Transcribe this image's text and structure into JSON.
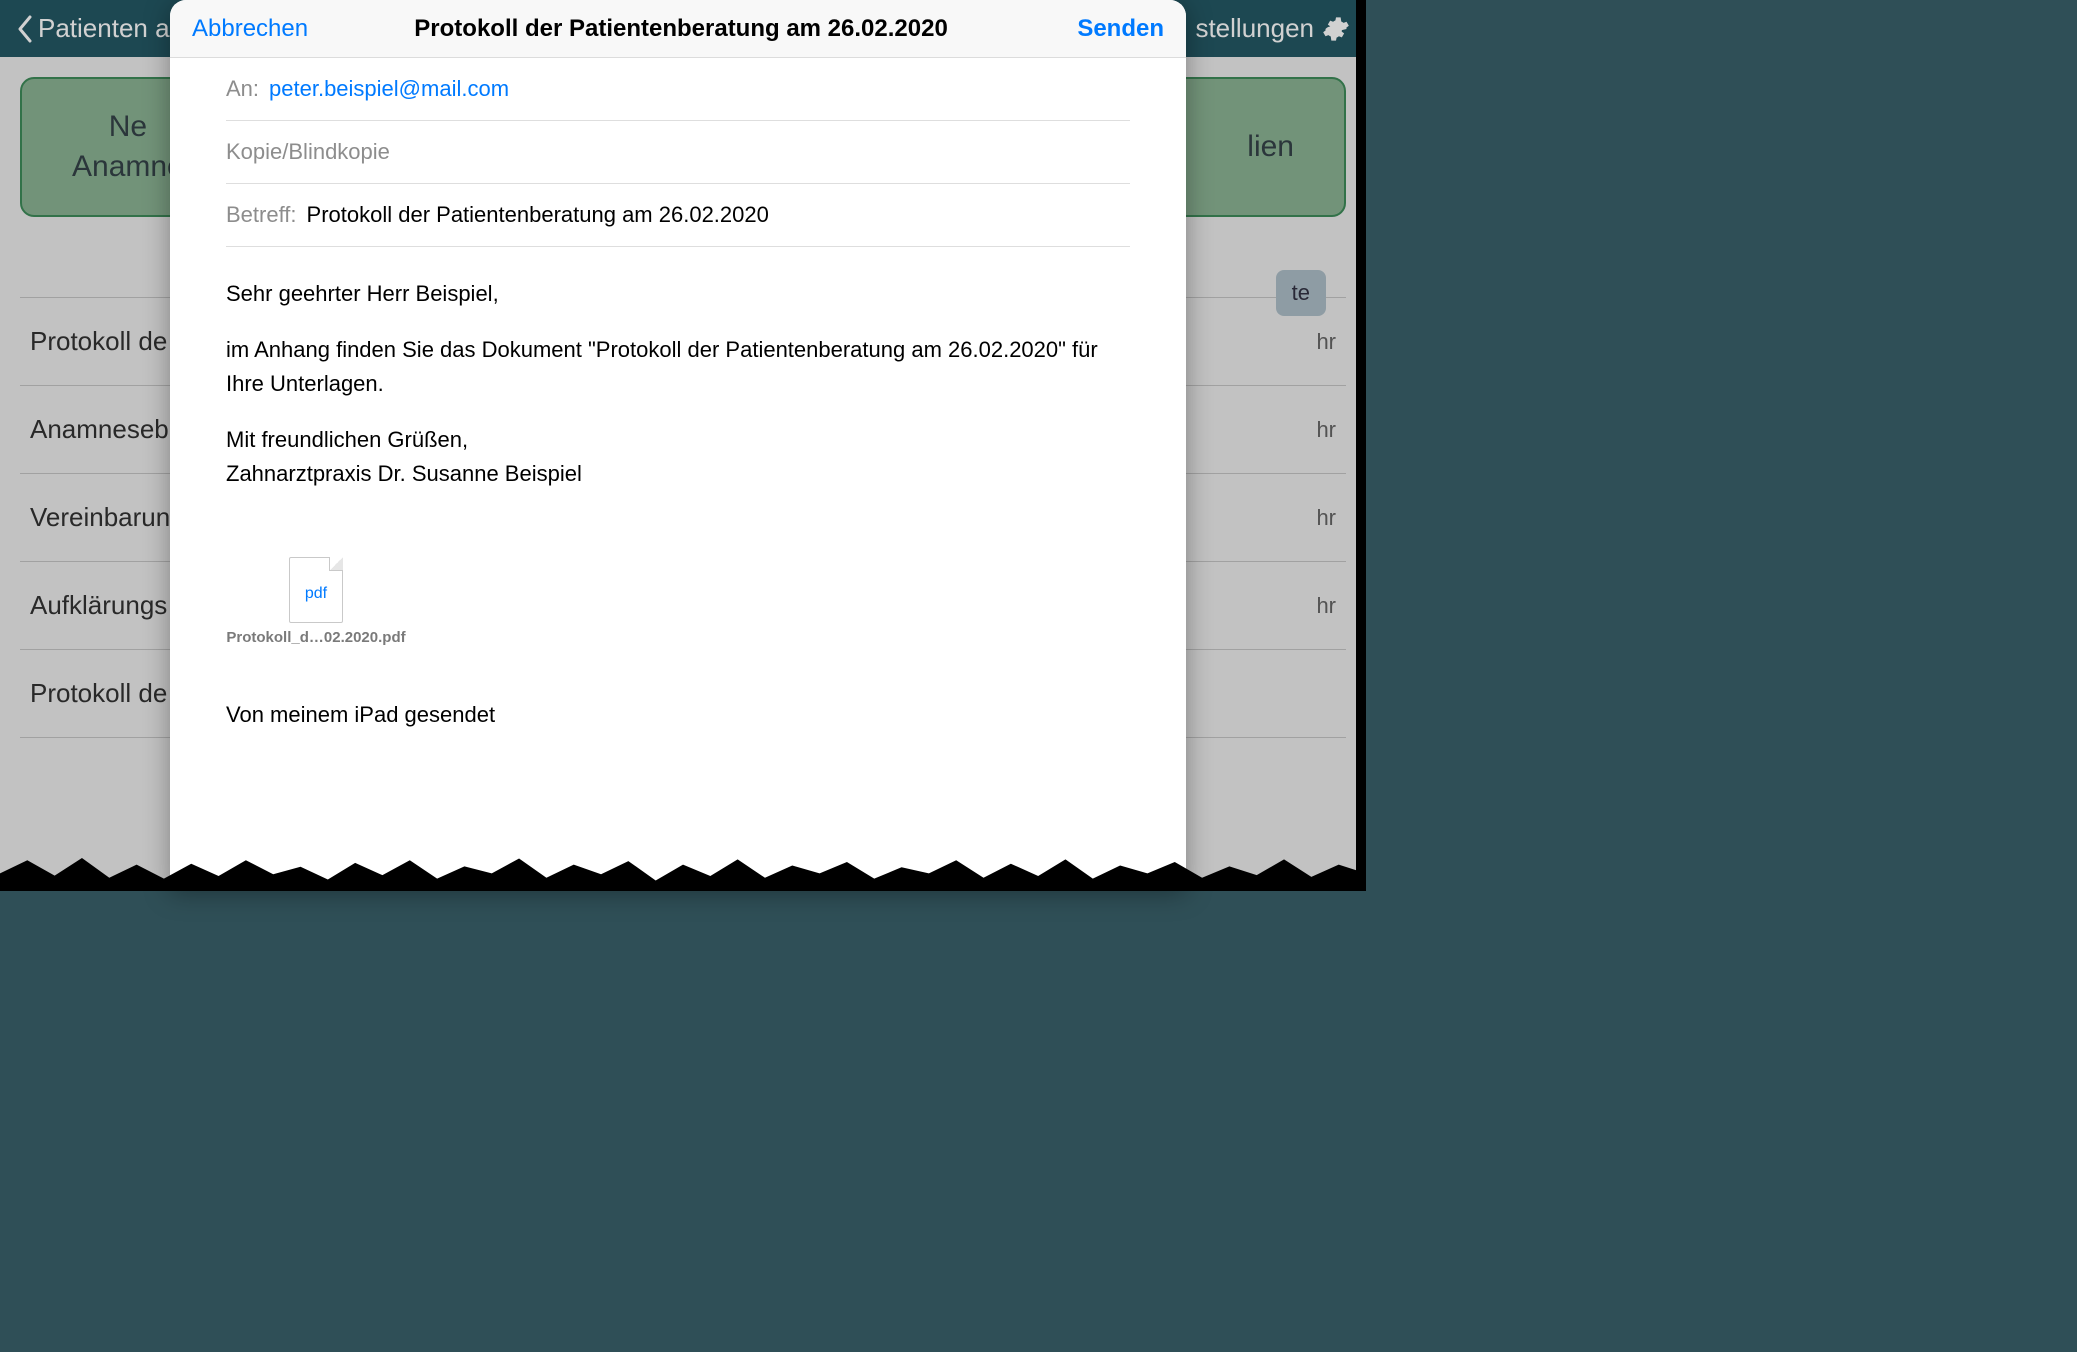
{
  "bg": {
    "back_label": "Patienten aus",
    "settings_label": "stellungen",
    "green_left_l1": "Ne",
    "green_left_l2": "Anamne",
    "green_right": "lien",
    "badge": "te",
    "list": [
      {
        "title": "Protokoll de",
        "time": "hr"
      },
      {
        "title": "Anamneseb",
        "time": "hr"
      },
      {
        "title": "Vereinbarun",
        "time": "hr"
      },
      {
        "title": "Aufklärungs",
        "time": "hr"
      },
      {
        "title": "Protokoll de",
        "time": ""
      }
    ]
  },
  "modal": {
    "cancel": "Abbrechen",
    "title": "Protokoll der Patientenberatung am 26.02.2020",
    "send": "Senden",
    "to_label": "An:",
    "to_value": "peter.beispiel@mail.com",
    "cc_label": "Kopie/Blindkopie",
    "subject_label": "Betreff:",
    "subject_value": "Protokoll der Patientenberatung am 26.02.2020",
    "body": {
      "salutation": "Sehr geehrter Herr Beispiel,",
      "paragraph": "im Anhang finden Sie das Dokument \"Protokoll der Patientenberatung am 26.02.2020\" für Ihre Unterlagen.",
      "closing": "Mit freundlichen Grüßen,",
      "signature": "Zahnarztpraxis Dr. Susanne Beispiel"
    },
    "attachment": {
      "ext": "pdf",
      "filename": "Protokoll_d…02.2020.pdf"
    },
    "sent_from": "Von meinem iPad gesendet"
  }
}
